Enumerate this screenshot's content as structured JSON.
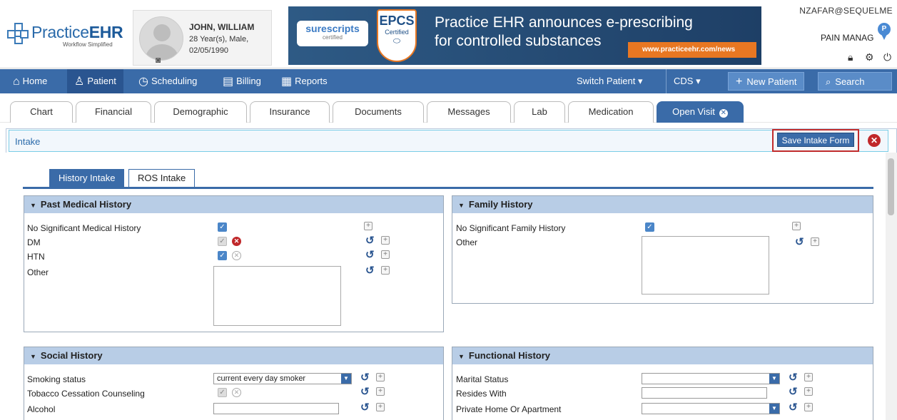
{
  "logo": {
    "brand_light": "Practice",
    "brand_bold": "EHR",
    "tagline": "Workflow Simplified"
  },
  "patient": {
    "name": "JOHN, WILLIAM",
    "age_sex": "28 Year(s), Male,",
    "dob": "02/05/1990"
  },
  "banner": {
    "surescripts": "surescripts",
    "surescripts_sub": "certified",
    "epcs": "EPCS",
    "epcs_sub": "Certified",
    "message_line1": "Practice EHR announces e-prescribing",
    "message_line2": "for controlled substances",
    "url": "www.practiceehr.com/news"
  },
  "user": {
    "email": "NZAFAR@SEQUELME",
    "facility": "PAIN MANAG",
    "pin_letter": "P"
  },
  "nav": {
    "home": "Home",
    "patient": "Patient",
    "scheduling": "Scheduling",
    "billing": "Billing",
    "reports": "Reports",
    "switch_patient": "Switch Patient",
    "cds": "CDS",
    "new_patient": "New Patient",
    "search": "Search"
  },
  "tabs": [
    "Chart",
    "Financial",
    "Demographic",
    "Insurance",
    "Documents",
    "Messages",
    "Lab",
    "Medication",
    "Open Visit"
  ],
  "intake": {
    "title": "Intake",
    "save_label": "Save Intake Form"
  },
  "subtabs": {
    "history": "History Intake",
    "ros": "ROS Intake"
  },
  "past_medical": {
    "title": "Past Medical History",
    "rows": [
      "No Significant Medical History",
      "DM",
      "HTN",
      "Other"
    ]
  },
  "family": {
    "title": "Family History",
    "rows": [
      "No Significant Family History",
      "Other"
    ]
  },
  "social": {
    "title": "Social History",
    "rows": [
      "Smoking status",
      "Tobacco Cessation Counseling",
      "Alcohol"
    ],
    "smoking_value": "current every day smoker"
  },
  "functional": {
    "title": "Functional History",
    "rows": [
      "Marital Status",
      "Resides With",
      "Private Home Or Apartment"
    ]
  },
  "colors": {
    "nav": "#3a6ba8",
    "panel_header": "#b8cde6",
    "highlight": "#c12c2c"
  }
}
